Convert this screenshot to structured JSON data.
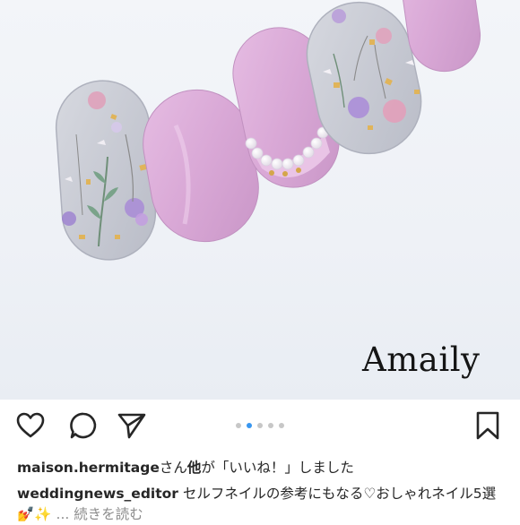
{
  "post": {
    "watermark": "Amaily",
    "carousel": {
      "count": 5,
      "active_index": 1
    }
  },
  "actions": {
    "like_icon": "heart-outline-icon",
    "comment_icon": "speech-bubble-icon",
    "share_icon": "paper-plane-icon",
    "save_icon": "bookmark-outline-icon"
  },
  "likes": {
    "user": "maison.hermitage",
    "text_part1": "さん",
    "others": "他",
    "text_part2": "が「いいね！」しました"
  },
  "caption": {
    "user": "weddingnews_editor",
    "text": "セルフネイルの参考にもなる♡おしゃれネイル5選",
    "emoji": "💅✨",
    "ellipsis": "...",
    "more_label": "続きを読む"
  },
  "colors": {
    "nail_pink": "#d9a9d6",
    "clear_gel": "#c9ccd6",
    "like_dot_active": "#3897f0",
    "text": "#262626",
    "muted": "#8e8e8e"
  }
}
